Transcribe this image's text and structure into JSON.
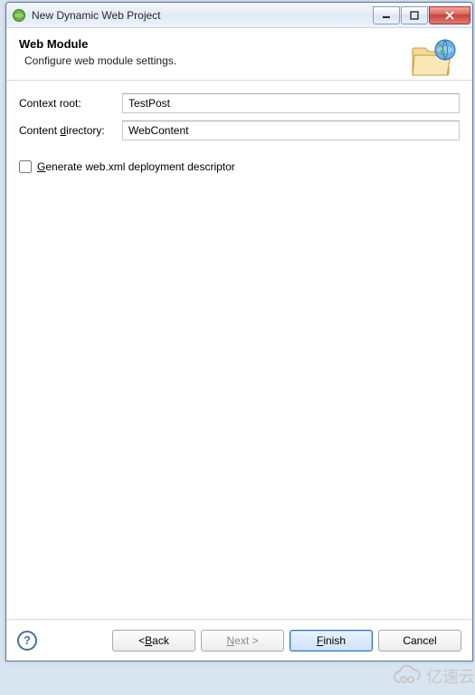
{
  "window": {
    "title": "New Dynamic Web Project"
  },
  "banner": {
    "heading": "Web Module",
    "subtext": "Configure web module settings."
  },
  "form": {
    "contextRootLabel": "Context root:",
    "contextRootValue": "TestPost",
    "contentDirLabelPre": "Content ",
    "contentDirLabelU": "d",
    "contentDirLabelPost": "irectory:",
    "contentDirValue": "WebContent",
    "genWebXmlPre": "",
    "genWebXmlU": "G",
    "genWebXmlPost": "enerate web.xml deployment descriptor"
  },
  "buttons": {
    "help": "?",
    "backPre": "< ",
    "backU": "B",
    "backPost": "ack",
    "nextPre": "",
    "nextU": "N",
    "nextPost": "ext >",
    "finishPre": "",
    "finishU": "F",
    "finishPost": "inish",
    "cancel": "Cancel"
  },
  "watermark": {
    "text": "亿速云"
  }
}
